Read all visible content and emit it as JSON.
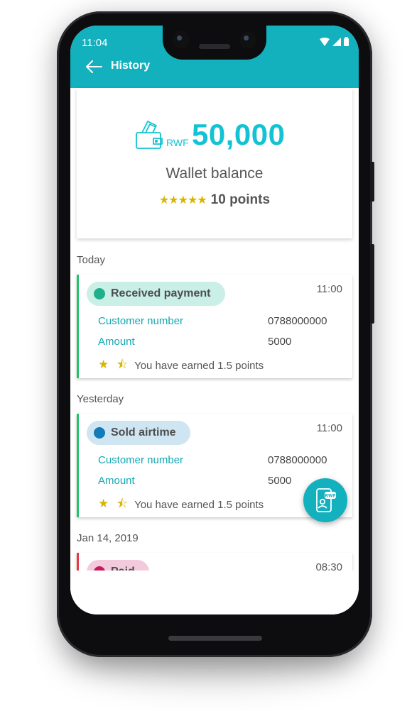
{
  "status_bar": {
    "time": "11:04"
  },
  "app_bar": {
    "title": "History"
  },
  "wallet": {
    "currency": "RWF",
    "balance": "50,000",
    "label": "Wallet balance",
    "points": "10 points",
    "stars": 5
  },
  "sections": [
    {
      "label": "Today"
    },
    {
      "label": "Yesterday"
    },
    {
      "label": "Jan 14, 2019"
    }
  ],
  "transactions": [
    {
      "title": "Received payment",
      "time": "11:00",
      "pill_color": "#c9efe7",
      "dot_color": "#1db08a",
      "border_color": "#24c26a",
      "customer_label": "Customer number",
      "customer_value": "0788000000",
      "amount_label": "Amount",
      "amount_value": "5000",
      "earned": "You have earned 1.5 points"
    },
    {
      "title": "Sold airtime",
      "time": "11:00",
      "pill_color": "#cfe6f2",
      "dot_color": "#127bb8",
      "border_color": "#24c26a",
      "customer_label": "Customer number",
      "customer_value": "0788000000",
      "amount_label": "Amount",
      "amount_value": "5000",
      "earned": "You have earned 1.5 points"
    },
    {
      "title": "Paid",
      "time": "08:30",
      "pill_color": "#f3c9dc",
      "dot_color": "#c8195e",
      "border_color": "#e63946"
    }
  ],
  "fab": {
    "badge": "RWF",
    "icon": "wallet-phone-icon"
  },
  "colors": {
    "primary": "#13b0bd",
    "accent": "#13c3d3",
    "star": "#d6b600"
  }
}
